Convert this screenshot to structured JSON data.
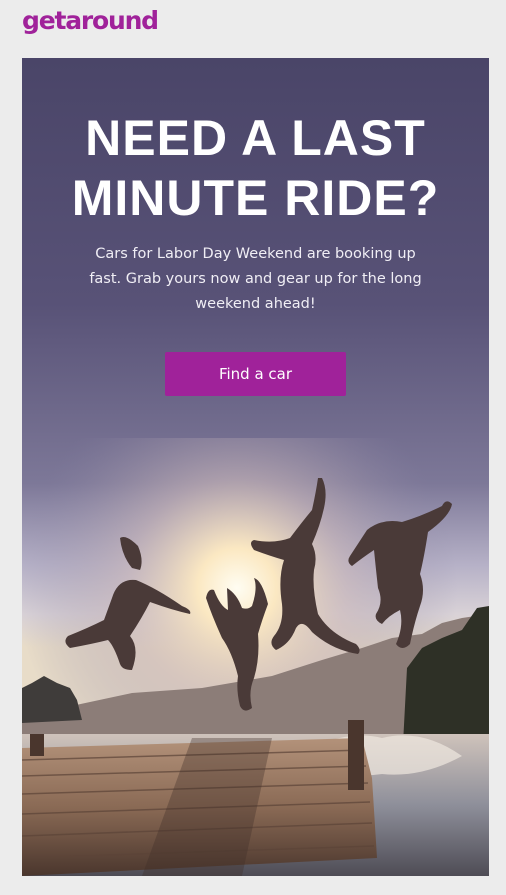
{
  "brand": {
    "logo_text": "getaround",
    "color": "#a0229a"
  },
  "hero": {
    "headline_line1": "NEED A LAST",
    "headline_line2": "MINUTE RIDE?",
    "body": "Cars for Labor Day Weekend are booking up fast. Grab yours now and gear up for the long weekend ahead!",
    "cta_label": "Find a car"
  },
  "colors": {
    "background": "#ececec",
    "hero_sky": "#4a4568",
    "button": "#a0229a"
  },
  "image": {
    "icon": "photo-friends-jumping-off-dock"
  }
}
